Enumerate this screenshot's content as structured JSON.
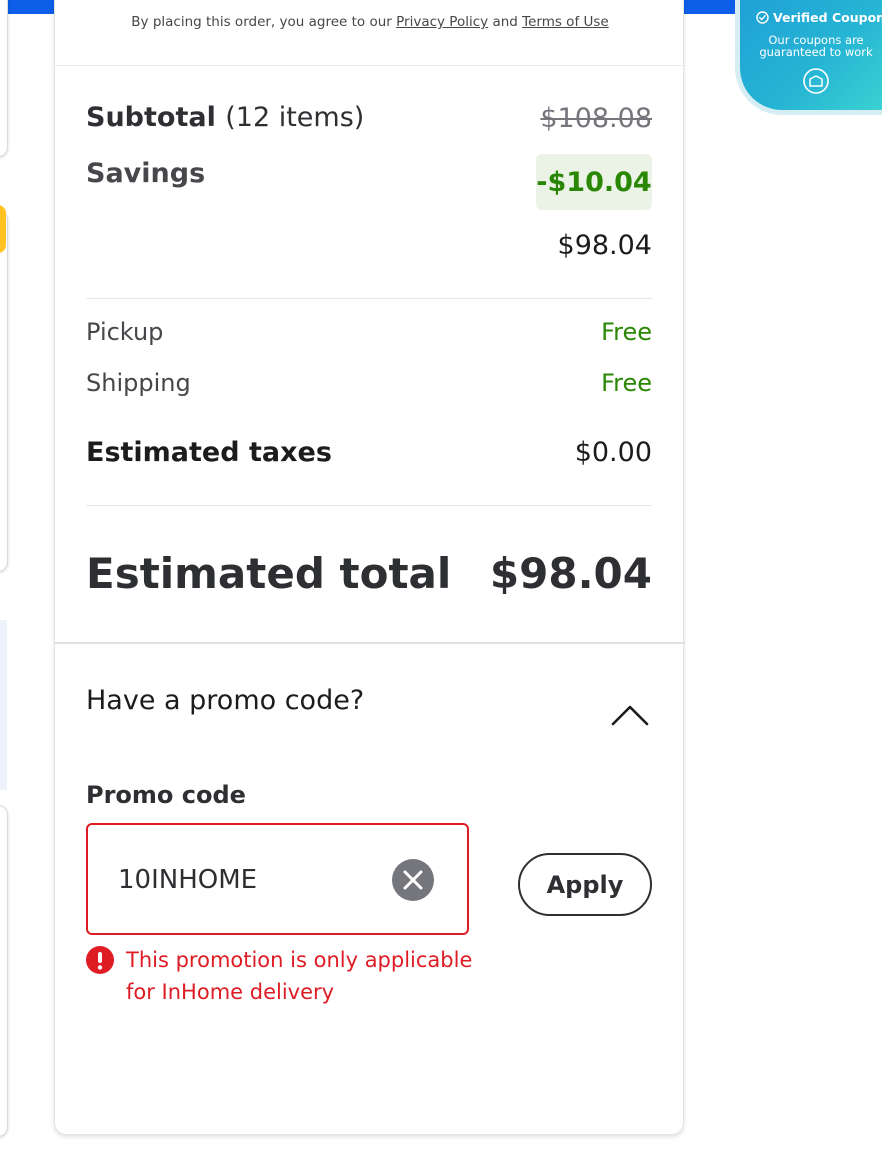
{
  "legal": {
    "prefix": "By placing this order, you agree to our",
    "privacy_link": "Privacy Policy",
    "and": "and",
    "terms_link": "Terms of Use"
  },
  "summary": {
    "subtotal_label": "Subtotal",
    "subtotal_count": "(12 items)",
    "subtotal_value": "$108.08",
    "savings_label": "Savings",
    "savings_value": "-$10.04",
    "discounted_value": "$98.04",
    "pickup_label": "Pickup",
    "pickup_value": "Free",
    "shipping_label": "Shipping",
    "shipping_value": "Free",
    "taxes_label": "Estimated taxes",
    "taxes_value": "$0.00",
    "total_label": "Estimated total",
    "total_value": "$98.04"
  },
  "promo": {
    "question": "Have a promo code?",
    "field_label": "Promo code",
    "value": "10INHOME",
    "apply_label": "Apply",
    "error": "This promotion is only applicable for InHome delivery"
  },
  "coupon_widget": {
    "title": "Verified Coupon",
    "subtitle": "Our coupons are guaranteed to work"
  },
  "colors": {
    "brand_blue": "#0d5ee8",
    "savings_green": "#2a8703",
    "error_red": "#de1c24"
  }
}
